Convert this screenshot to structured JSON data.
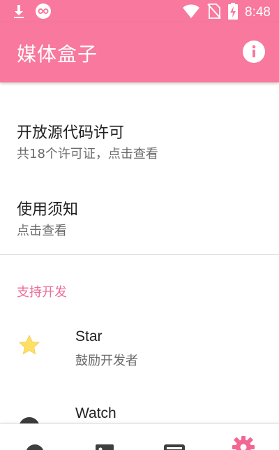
{
  "status_bar": {
    "time": "8:48",
    "icons": [
      "download-icon",
      "infinity-app-icon",
      "wifi-icon",
      "no-sim-icon",
      "battery-charging-icon"
    ]
  },
  "app_bar": {
    "title": "媒体盒子",
    "action_icon": "info-icon"
  },
  "colors": {
    "primary": "#f8789e",
    "accent": "#ee6d96",
    "star": "#ffe066"
  },
  "preferences": [
    {
      "title": "开放源代码许可",
      "summary": "共18个许可证，点击查看"
    },
    {
      "title": "使用须知",
      "summary": "点击查看"
    }
  ],
  "support_section": {
    "header": "支持开发",
    "items": [
      {
        "icon": "star-icon",
        "title": "Star",
        "summary": "鼓励开发者"
      },
      {
        "icon": "eye-icon",
        "title": "Watch",
        "summary": ""
      }
    ]
  },
  "bottom_nav": {
    "items": [
      {
        "icon": "compass-icon",
        "active": false
      },
      {
        "icon": "image-icon",
        "active": false
      },
      {
        "icon": "tv-icon",
        "active": false
      },
      {
        "icon": "settings-gear-icon",
        "active": true
      }
    ]
  }
}
